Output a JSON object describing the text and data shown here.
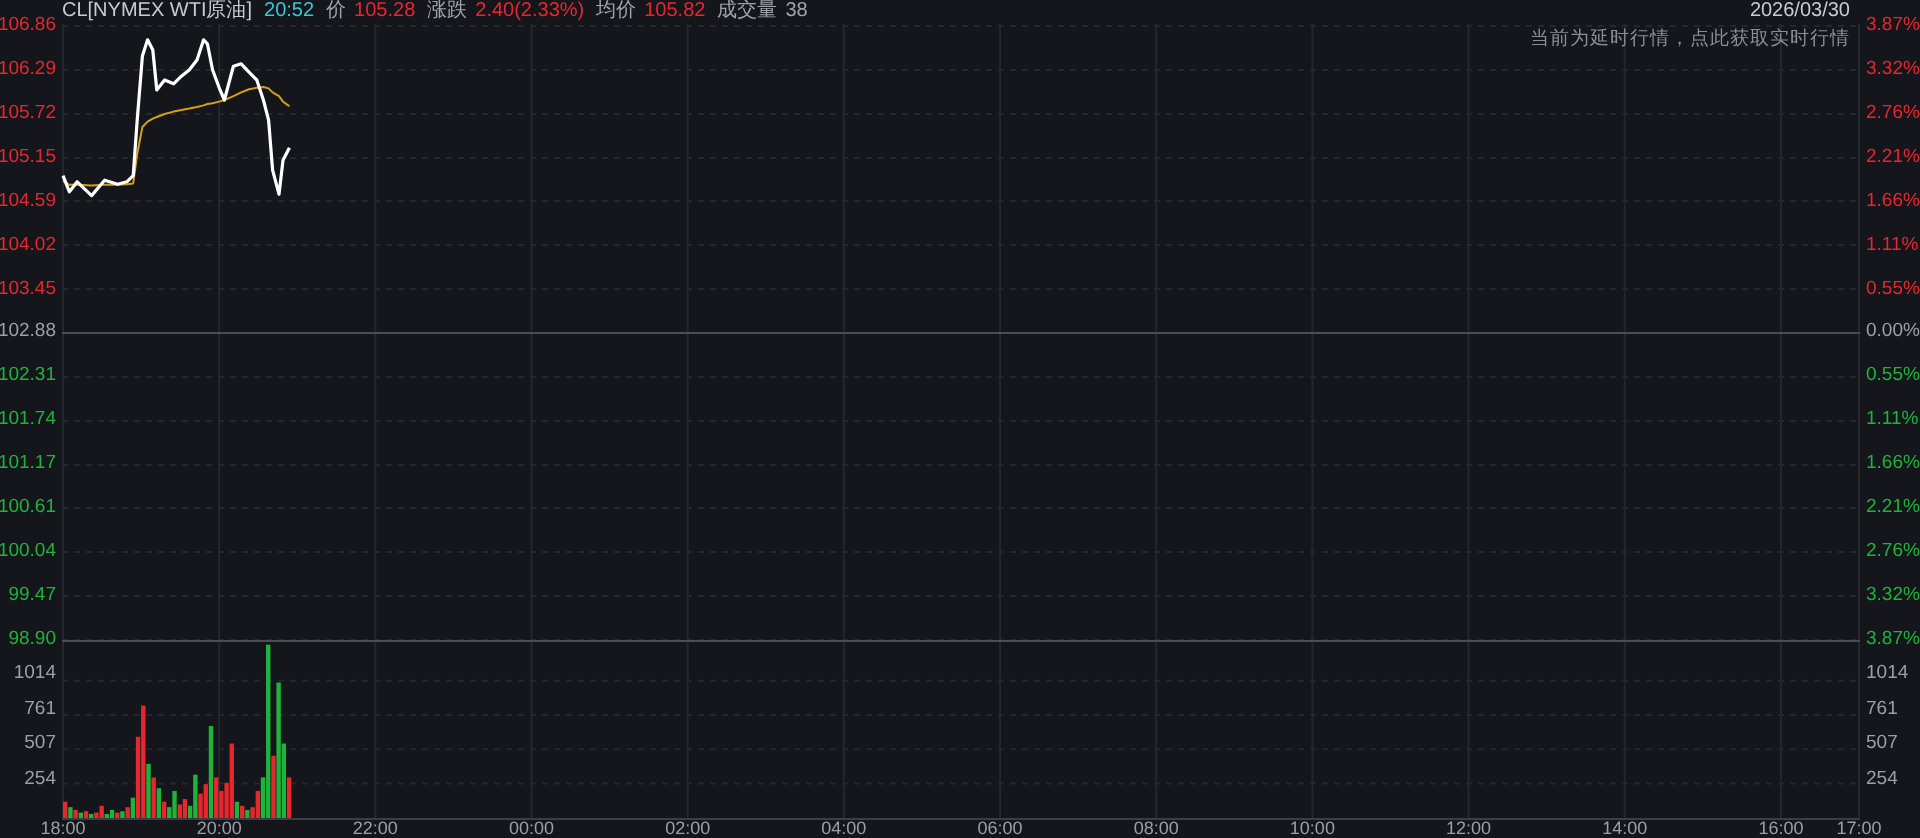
{
  "header": [
    {
      "text": "CL[NYMEX WTI原油]",
      "kind": "name"
    },
    {
      "text": "20:52",
      "kind": "time"
    },
    {
      "text": "价",
      "kind": "label"
    },
    {
      "text": "105.28",
      "kind": "up"
    },
    {
      "text": "涨跌",
      "kind": "label"
    },
    {
      "text": "2.40(2.33%)",
      "kind": "up"
    },
    {
      "text": "均价",
      "kind": "label"
    },
    {
      "text": "105.82",
      "kind": "up"
    },
    {
      "text": "成交量",
      "kind": "label"
    },
    {
      "text": "38",
      "kind": "plain"
    }
  ],
  "date": "2026/03/30",
  "notice": "当前为延时行情，点此获取实时行情",
  "percent_axis": [
    {
      "label": "3.87%",
      "color": "#e8262d"
    },
    {
      "label": "3.32%",
      "color": "#e8262d"
    },
    {
      "label": "2.76%",
      "color": "#e8262d"
    },
    {
      "label": "2.21%",
      "color": "#e8262d"
    },
    {
      "label": "1.66%",
      "color": "#e8262d"
    },
    {
      "label": "1.11%",
      "color": "#e8262d"
    },
    {
      "label": "0.55%",
      "color": "#e8262d"
    },
    {
      "label": "0.00%",
      "color": "#9aa0a6"
    },
    {
      "label": "0.55%",
      "color": "#1fb33a"
    },
    {
      "label": "1.11%",
      "color": "#1fb33a"
    },
    {
      "label": "1.66%",
      "color": "#1fb33a"
    },
    {
      "label": "2.21%",
      "color": "#1fb33a"
    },
    {
      "label": "2.76%",
      "color": "#1fb33a"
    },
    {
      "label": "3.32%",
      "color": "#1fb33a"
    },
    {
      "label": "3.87%",
      "color": "#1fb33a"
    }
  ],
  "volume_right_axis": [
    "1014",
    "761",
    "507",
    "254"
  ],
  "time_axis": [
    "00:00",
    "02:00",
    "04:00",
    "06:00",
    "08:00",
    "10:00",
    "12:00",
    "14:00",
    "16:00",
    "17:00"
  ],
  "price_chart": {
    "chart_data": {
      "type": "line",
      "grid": true,
      "ref_lines": [
        {
          "axis": "y",
          "value": 102.88
        }
      ],
      "xlim": [
        18,
        41
      ],
      "ylim": [
        98.9,
        106.86
      ],
      "yticks": [
        {
          "value": 106.86,
          "label": "106.86"
        },
        {
          "value": 106.29,
          "label": "106.29"
        },
        {
          "value": 105.72,
          "label": "105.72"
        },
        {
          "value": 105.15,
          "label": "105.15"
        },
        {
          "value": 104.59,
          "label": "104.59"
        },
        {
          "value": 104.02,
          "label": "104.02"
        },
        {
          "value": 103.45,
          "label": "103.45"
        },
        {
          "value": 102.88,
          "label": "102.88"
        },
        {
          "value": 102.31,
          "label": "102.31"
        },
        {
          "value": 101.74,
          "label": "101.74"
        },
        {
          "value": 101.17,
          "label": "101.17"
        },
        {
          "value": 100.61,
          "label": "100.61"
        },
        {
          "value": 100.04,
          "label": "100.04"
        },
        {
          "value": 99.47,
          "label": "99.47"
        },
        {
          "value": 98.9,
          "label": "98.90"
        }
      ],
      "x": [
        18,
        18.083,
        18.183,
        18.367,
        18.533,
        18.7,
        18.817,
        18.9,
        18.95,
        19.017,
        19.083,
        19.15,
        19.2,
        19.3,
        19.417,
        19.517,
        19.617,
        19.717,
        19.8,
        19.85,
        19.917,
        20,
        20.067,
        20.183,
        20.283,
        20.383,
        20.483,
        20.567,
        20.633,
        20.683,
        20.767,
        20.817,
        20.9
      ],
      "series": [
        {
          "color": "#ffffff",
          "values": [
            104.92,
            104.71,
            104.84,
            104.66,
            104.86,
            104.81,
            104.84,
            104.92,
            105.64,
            106.47,
            106.68,
            106.55,
            106.03,
            106.16,
            106.11,
            106.21,
            106.29,
            106.42,
            106.68,
            106.63,
            106.29,
            106.06,
            105.9,
            106.34,
            106.37,
            106.26,
            106.16,
            105.9,
            105.64,
            104.99,
            104.68,
            105.12,
            105.28
          ]
        },
        {
          "color": "#d4a017",
          "values": [
            104.85,
            104.8,
            104.8,
            104.79,
            104.8,
            104.8,
            104.81,
            104.82,
            105.2,
            105.55,
            105.62,
            105.66,
            105.68,
            105.72,
            105.75,
            105.77,
            105.79,
            105.81,
            105.83,
            105.85,
            105.86,
            105.88,
            105.9,
            105.95,
            106.0,
            106.04,
            106.06,
            106.07,
            106.05,
            106.0,
            105.95,
            105.88,
            105.82
          ]
        }
      ]
    }
  },
  "volume_chart": {
    "chart_data": {
      "type": "bar",
      "grid": true,
      "xlim": [
        18,
        41
      ],
      "xticks": [
        {
          "value": 18,
          "label": "18:00"
        },
        {
          "value": 20,
          "label": "20:00"
        },
        {
          "value": 22,
          "label": "22:00"
        }
      ],
      "ylim": [
        0,
        1300
      ],
      "yticks": [
        {
          "value": 1014,
          "label": "1014"
        },
        {
          "value": 761,
          "label": "761"
        },
        {
          "value": 507,
          "label": "507"
        },
        {
          "value": 254,
          "label": "254"
        }
      ],
      "x": [
        18,
        18.067,
        18.133,
        18.2,
        18.267,
        18.333,
        18.4,
        18.467,
        18.533,
        18.6,
        18.667,
        18.733,
        18.8,
        18.867,
        18.933,
        19,
        19.067,
        19.133,
        19.2,
        19.267,
        19.333,
        19.4,
        19.467,
        19.533,
        19.6,
        19.667,
        19.733,
        19.8,
        19.867,
        19.933,
        20,
        20.067,
        20.133,
        20.2,
        20.267,
        20.333,
        20.4,
        20.467,
        20.533,
        20.6,
        20.667,
        20.733,
        20.8,
        20.867
      ],
      "series": [
        {
          "color": "#e8262d",
          "values": [
            120,
            null,
            60,
            null,
            50,
            null,
            40,
            90,
            null,
            null,
            40,
            null,
            80,
            null,
            600,
            830,
            null,
            300,
            null,
            120,
            null,
            null,
            100,
            140,
            null,
            null,
            180,
            250,
            null,
            300,
            200,
            260,
            550,
            null,
            90,
            null,
            80,
            200,
            null,
            null,
            460,
            null,
            null,
            300
          ]
        },
        {
          "color": "#1fb33a",
          "values": [
            null,
            80,
            null,
            40,
            null,
            30,
            null,
            null,
            30,
            60,
            null,
            50,
            null,
            150,
            null,
            null,
            400,
            null,
            220,
            null,
            80,
            200,
            null,
            null,
            90,
            320,
            null,
            null,
            680,
            null,
            null,
            null,
            null,
            120,
            null,
            60,
            null,
            null,
            300,
            1280,
            null,
            1000,
            550,
            null
          ]
        }
      ]
    }
  }
}
